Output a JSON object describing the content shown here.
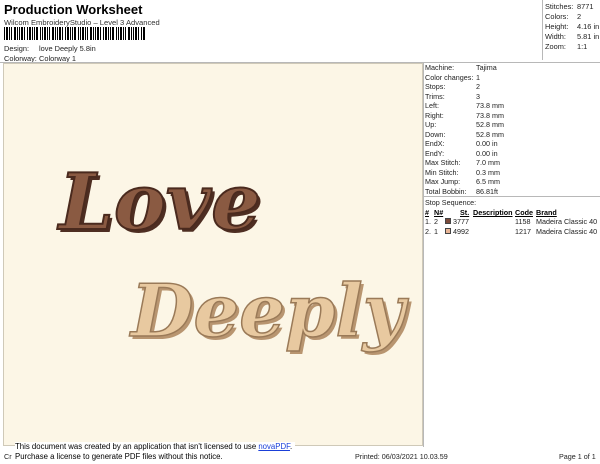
{
  "header": {
    "title": "Production Worksheet",
    "subtitle": "Wilcom EmbroideryStudio – Level 3 Advanced",
    "design_label": "Design:",
    "design_value": "love Deeply 5.8in",
    "colorway_label": "Colorway:",
    "colorway_value": "Colorway 1"
  },
  "summary": {
    "stitches_label": "Stitches:",
    "stitches_value": "8771",
    "colors_label": "Colors:",
    "colors_value": "2",
    "height_label": "Height:",
    "height_value": "4.16 in",
    "width_label": "Width:",
    "width_value": "5.81 in",
    "zoom_label": "Zoom:",
    "zoom_value": "1:1"
  },
  "design": {
    "line1": "Love",
    "line2": "Deeply",
    "color1": "#8a5a42",
    "color2": "#e8c9a0"
  },
  "machine": [
    {
      "label": "Machine:",
      "value": "Tajima"
    },
    {
      "label": "Color changes:",
      "value": "1"
    },
    {
      "label": "Stops:",
      "value": "2"
    },
    {
      "label": "Trims:",
      "value": "3"
    },
    {
      "label": "Left:",
      "value": "73.8 mm"
    },
    {
      "label": "Right:",
      "value": "73.8 mm"
    },
    {
      "label": "Up:",
      "value": "52.8 mm"
    },
    {
      "label": "Down:",
      "value": "52.8 mm"
    },
    {
      "label": "EndX:",
      "value": "0.00 in"
    },
    {
      "label": "EndY:",
      "value": "0.00 in"
    },
    {
      "label": "Max Stitch:",
      "value": "7.0 mm"
    },
    {
      "label": "Min Stitch:",
      "value": "0.3 mm"
    },
    {
      "label": "Max Jump:",
      "value": "6.5 mm"
    },
    {
      "label": "Total Bobbin:",
      "value": "86.81ft"
    }
  ],
  "stop_sequence": {
    "title": "Stop Sequence:",
    "headers": {
      "num": "#",
      "n": "N#",
      "st": "St.",
      "description": "Description",
      "code": "Code",
      "brand": "Brand"
    },
    "rows": [
      {
        "num": "1.",
        "n": "2",
        "color": "#7a4a3a",
        "st": "3777",
        "description": "",
        "code": "1158",
        "brand": "Madeira Classic 40"
      },
      {
        "num": "2.",
        "n": "1",
        "color": "#e8b596",
        "st": "4992",
        "description": "",
        "code": "1217",
        "brand": "Madeira Classic 40"
      }
    ]
  },
  "footer": {
    "notice_text": "This document was created by an application that isn't licensed to use ",
    "notice_link": "novaPDF",
    "notice_end": ".",
    "notice_line2": "Purchase a license to generate PDF files without this notice.",
    "left": "Cr",
    "printed": "Printed: 06/03/2021 10.03.59",
    "page": "Page 1 of 1"
  }
}
